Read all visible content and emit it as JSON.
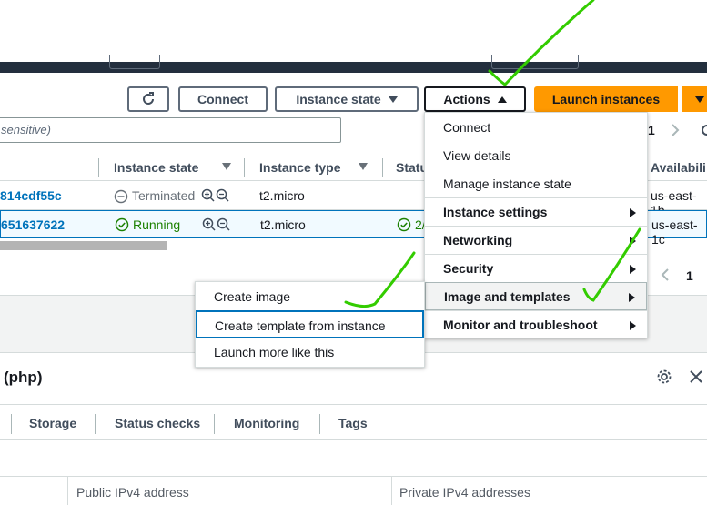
{
  "toolbar": {
    "connect_label": "Connect",
    "instance_state_label": "Instance state",
    "actions_label": "Actions",
    "launch_label": "Launch instances"
  },
  "search": {
    "placeholder": "sensitive)"
  },
  "pagination": {
    "current_page": "1",
    "bottom_page": "1"
  },
  "table": {
    "columns": [
      "Instance state",
      "Instance type",
      "Statu",
      "Availabili"
    ],
    "rows": [
      {
        "instance_id": "814cdf55c",
        "state": "Terminated",
        "type": "t2.micro",
        "status": "–",
        "zone": "us-east-1b"
      },
      {
        "instance_id": "651637622",
        "state": "Running",
        "type": "t2.micro",
        "status": "2/",
        "zone": "us-east-1c"
      }
    ]
  },
  "actions_menu": {
    "items": [
      {
        "label": "Connect"
      },
      {
        "label": "View details"
      },
      {
        "label": "Manage instance state"
      },
      {
        "label": "Instance settings"
      },
      {
        "label": "Networking"
      },
      {
        "label": "Security"
      },
      {
        "label": "Image and templates"
      },
      {
        "label": "Monitor and troubleshoot"
      }
    ]
  },
  "submenu": {
    "items": [
      {
        "label": "Create image"
      },
      {
        "label": "Create template from instance"
      },
      {
        "label": "Launch more like this"
      }
    ]
  },
  "details": {
    "title": "(php)",
    "tabs": [
      "Storage",
      "Status checks",
      "Monitoring",
      "Tags"
    ],
    "labels": [
      "Public IPv4 address",
      "Private IPv4 addresses"
    ]
  },
  "colors": {
    "accent": "#ff9900",
    "link": "#0073bb",
    "topbar": "#232f3e",
    "annotation": "#33cc00"
  },
  "icons": [
    "refresh-icon",
    "caret-down-icon",
    "caret-up-icon",
    "sort-icon",
    "zoom-in-icon",
    "zoom-out-icon",
    "terminated-icon",
    "running-check-icon",
    "chevron-right-icon",
    "chevron-left-icon",
    "settings-gear-icon",
    "close-icon"
  ]
}
